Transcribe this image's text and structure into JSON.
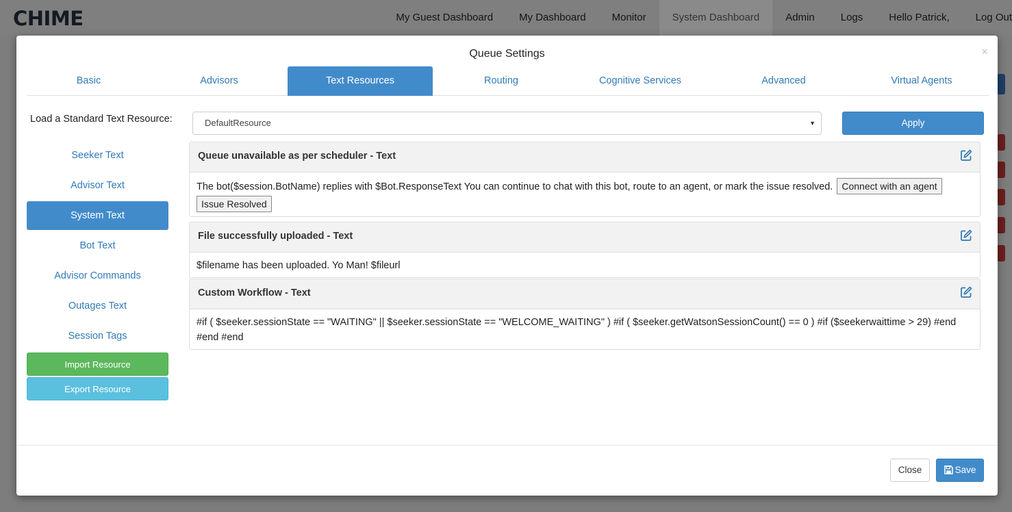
{
  "app": {
    "logo": "CHIME"
  },
  "nav": {
    "items": [
      "My Guest Dashboard",
      "My Dashboard",
      "Monitor",
      "System Dashboard",
      "Admin",
      "Logs",
      "Hello Patrick,",
      "Log Out"
    ],
    "active_index": 3
  },
  "modal": {
    "title": "Queue Settings",
    "close_x": "×",
    "tabs": [
      {
        "label": "Basic"
      },
      {
        "label": "Advisors"
      },
      {
        "label": "Text Resources"
      },
      {
        "label": "Routing"
      },
      {
        "label": "Cognitive Services"
      },
      {
        "label": "Advanced"
      },
      {
        "label": "Virtual Agents"
      }
    ],
    "active_tab": "Text Resources",
    "load_label": "Load a Standard Text Resource:",
    "select_value": "DefaultResource",
    "apply_label": "Apply",
    "sidenav": [
      "Seeker Text",
      "Advisor Text",
      "System Text",
      "Bot Text",
      "Advisor Commands",
      "Outages Text",
      "Session Tags"
    ],
    "sidenav_active": "System Text",
    "import_label": "Import Resource",
    "export_label": "Export Resource",
    "panels": [
      {
        "title": "Queue unavailable as per scheduler - Text",
        "body": "The bot($session.BotName) replies with $Bot.ResponseText You can continue to chat with this bot, route to an agent, or mark the issue resolved.",
        "buttons": [
          "Connect with an agent",
          "Issue Resolved"
        ]
      },
      {
        "title": "File successfully uploaded - Text",
        "body": "$filename has been uploaded. Yo Man! $fileurl"
      },
      {
        "title": "Custom Workflow - Text",
        "body": "#if ( $seeker.sessionState == \"WAITING\" || $seeker.sessionState == \"WELCOME_WAITING\" ) #if ( $seeker.getWatsonSessionCount() == 0 ) #if ($seekerwaittime > 29) #end #end #end"
      }
    ],
    "close_label": "Close",
    "save_label": "Save"
  },
  "colors": {
    "primary": "#428bca",
    "success": "#5cb85c",
    "info": "#5bc0de",
    "link": "#337ab7"
  },
  "icons": {
    "edit": "edit-icon",
    "save": "floppy-disk-icon",
    "caret": "chevron-down-icon"
  }
}
